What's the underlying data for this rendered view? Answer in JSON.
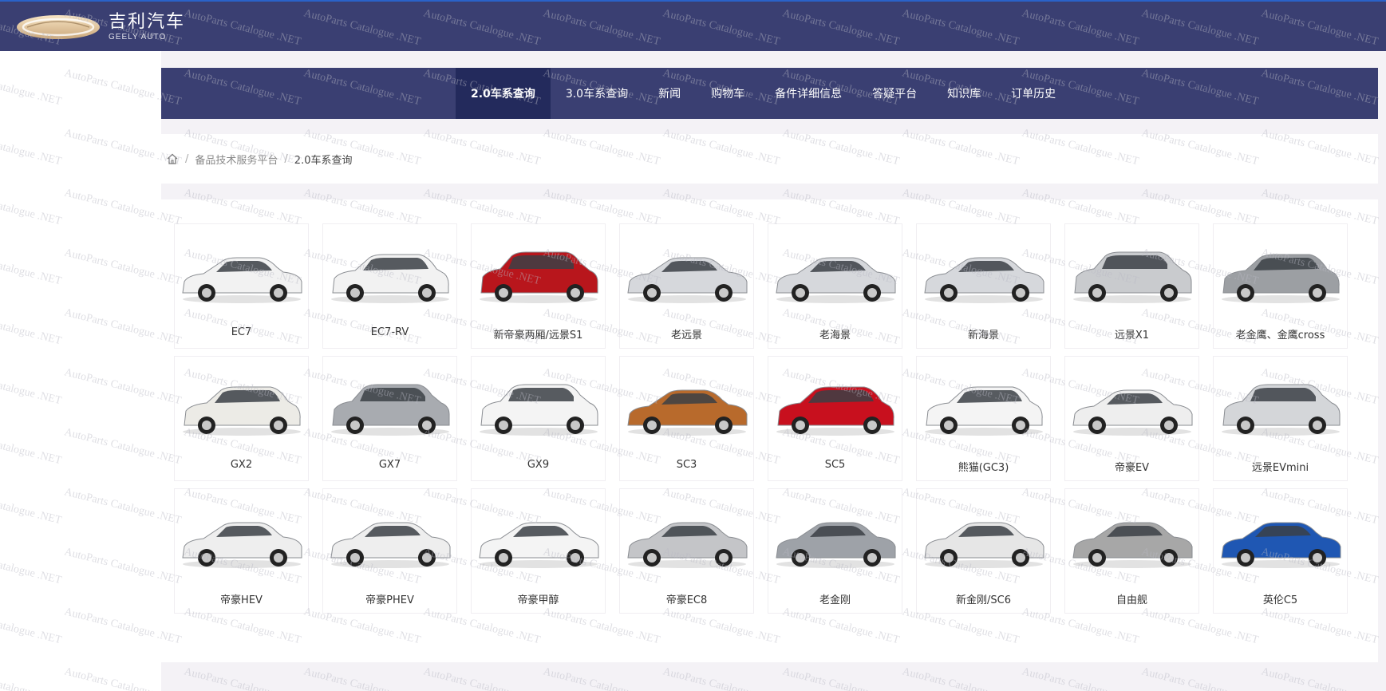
{
  "header": {
    "logo_cn": "吉利汽车",
    "logo_en": "GEELY AUTO"
  },
  "nav": {
    "items": [
      {
        "label": "2.0车系查询",
        "active": true
      },
      {
        "label": "3.0车系查询",
        "active": false
      },
      {
        "label": "新闻",
        "active": false
      },
      {
        "label": "购物车",
        "active": false
      },
      {
        "label": "备件详细信息",
        "active": false
      },
      {
        "label": "答疑平台",
        "active": false
      },
      {
        "label": "知识库",
        "active": false
      },
      {
        "label": "订单历史",
        "active": false
      }
    ]
  },
  "breadcrumb": {
    "home_icon": "home-icon",
    "items": [
      "备品技术服务平台",
      "2.0车系查询"
    ]
  },
  "watermark": {
    "text": "AutoParts Catalogue .NET"
  },
  "cars": [
    {
      "name": "EC7",
      "color": "#f2f2f2",
      "shape": "sedan"
    },
    {
      "name": "EC7-RV",
      "color": "#f2f2f2",
      "shape": "hatch"
    },
    {
      "name": "新帝豪两厢/远景S1",
      "color": "#b8161c",
      "shape": "suv"
    },
    {
      "name": "老远景",
      "color": "#d6d8dc",
      "shape": "sedan"
    },
    {
      "name": "老海景",
      "color": "#d6d8dc",
      "shape": "sedan"
    },
    {
      "name": "新海景",
      "color": "#d6d8dc",
      "shape": "sedan"
    },
    {
      "name": "远景X1",
      "color": "#c9cbce",
      "shape": "suv"
    },
    {
      "name": "老金鹰、金鹰cross",
      "color": "#9c9fa3",
      "shape": "hatch"
    },
    {
      "name": "GX2",
      "color": "#ecebe6",
      "shape": "hatch"
    },
    {
      "name": "GX7",
      "color": "#a8abb0",
      "shape": "suv"
    },
    {
      "name": "GX9",
      "color": "#f4f4f4",
      "shape": "suv"
    },
    {
      "name": "SC3",
      "color": "#b86a2c",
      "shape": "sedan"
    },
    {
      "name": "SC5",
      "color": "#c8101e",
      "shape": "hatch"
    },
    {
      "name": "熊猫(GC3)",
      "color": "#f4f4f4",
      "shape": "hatch"
    },
    {
      "name": "帝豪EV",
      "color": "#eeeeee",
      "shape": "sedan"
    },
    {
      "name": "远景EVmini",
      "color": "#d4d6d9",
      "shape": "suv"
    },
    {
      "name": "帝豪HEV",
      "color": "#eeeeee",
      "shape": "sedan"
    },
    {
      "name": "帝豪PHEV",
      "color": "#eeeeee",
      "shape": "sedan"
    },
    {
      "name": "帝豪甲醇",
      "color": "#f4f4f4",
      "shape": "sedan"
    },
    {
      "name": "帝豪EC8",
      "color": "#c4c5c8",
      "shape": "sedan"
    },
    {
      "name": "老金刚",
      "color": "#9ea2a8",
      "shape": "sedan"
    },
    {
      "name": "新金刚/SC6",
      "color": "#e6e6e6",
      "shape": "sedan"
    },
    {
      "name": "自由舰",
      "color": "#a7a7a7",
      "shape": "sedan"
    },
    {
      "name": "英伦C5",
      "color": "#1f57b3",
      "shape": "sedan"
    }
  ]
}
